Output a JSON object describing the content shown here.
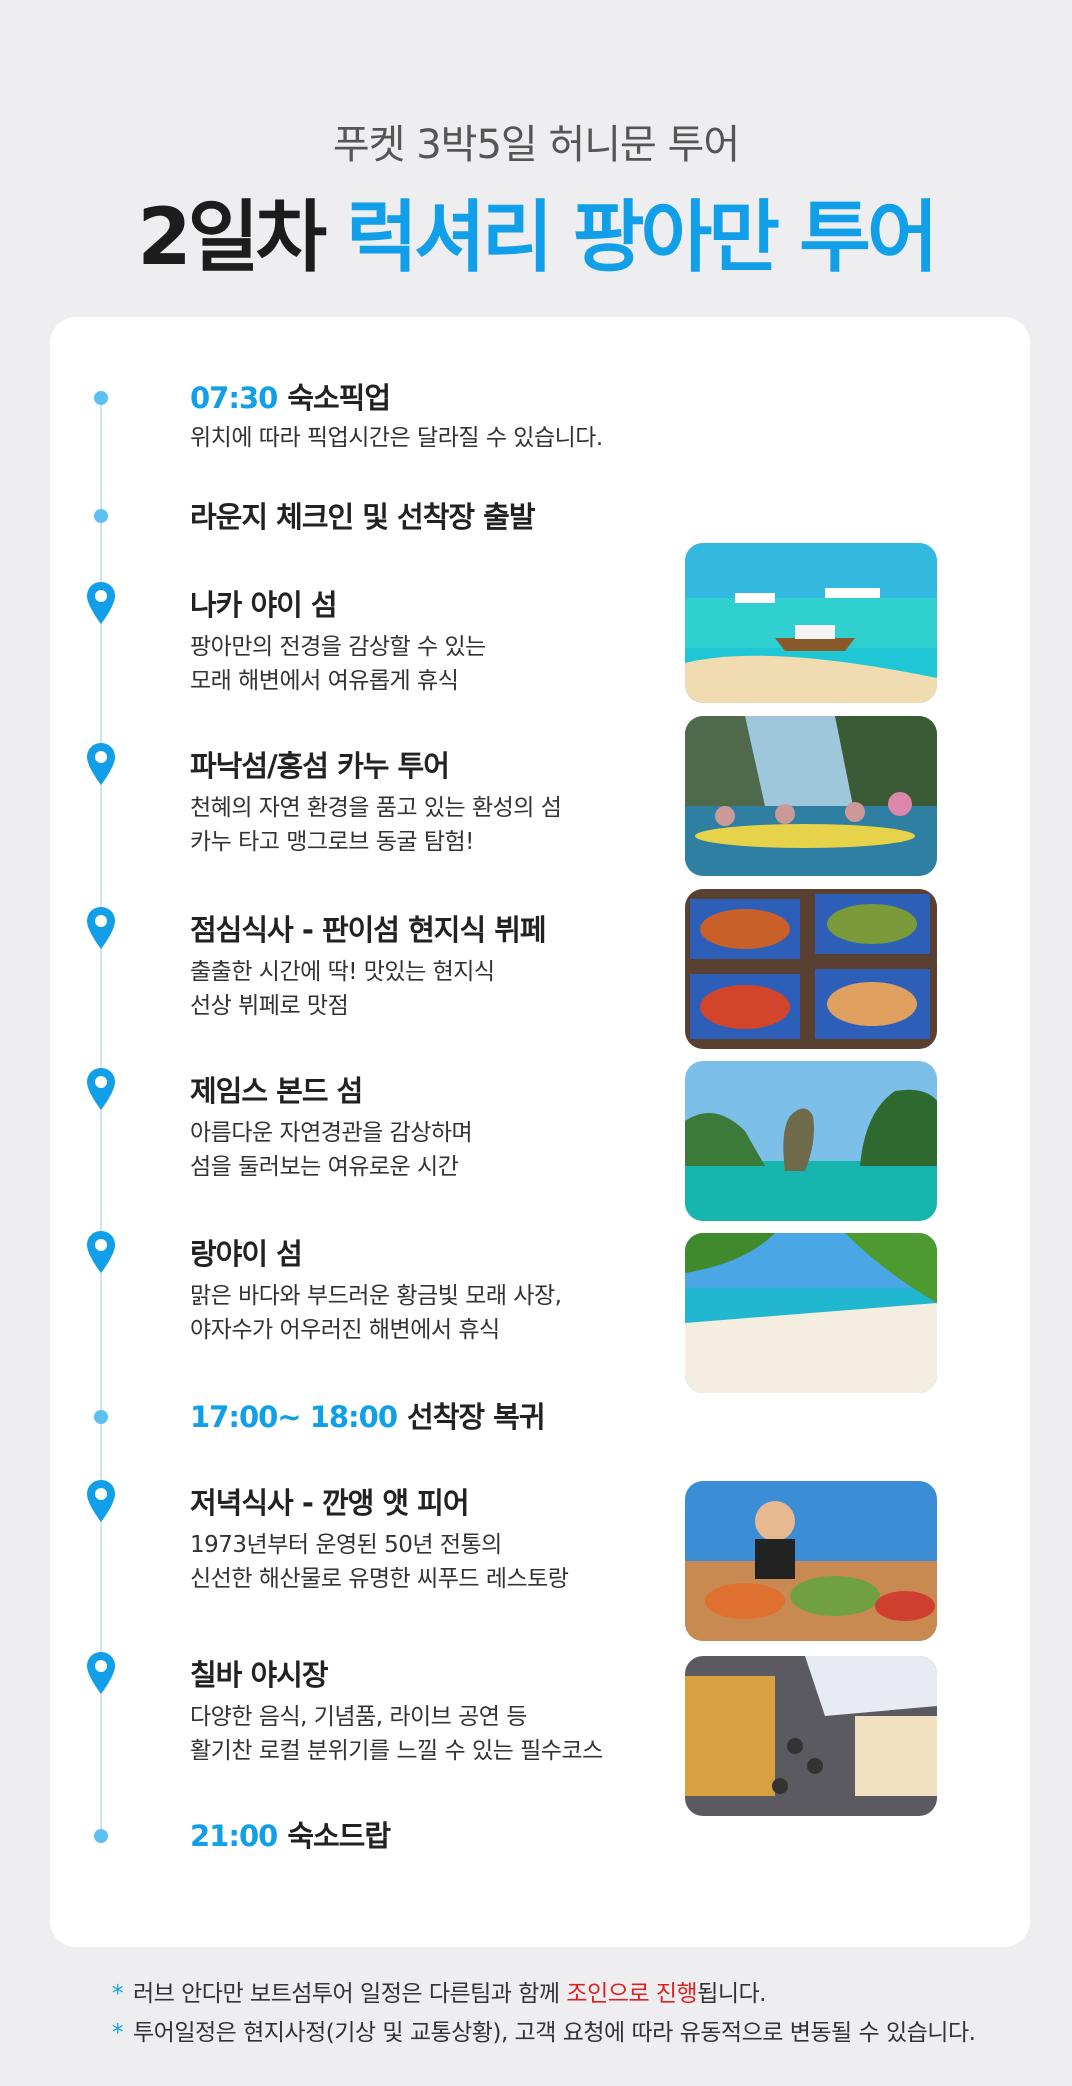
{
  "header": {
    "subtitle": "푸켓 3박5일 허니문 투어",
    "title_day": "2일차",
    "title_main": "럭셔리 팡아만 투어"
  },
  "schedule": [
    {
      "time": "07:30",
      "title": "숙소픽업",
      "desc": [
        "위치에 따라 픽업시간은 달라질 수 있습니다."
      ],
      "marker": "dot"
    },
    {
      "time": "",
      "title": "라운지 체크인 및 선착장 출발",
      "desc": [],
      "marker": "dot"
    },
    {
      "time": "",
      "title": "나카 야이 섬",
      "desc": [
        "팡아만의 전경을 감상할 수 있는",
        "모래 해변에서 여유롭게 휴식"
      ],
      "marker": "location-pin-icon",
      "photo": "beach-boats-photo"
    },
    {
      "time": "",
      "title": "파낙섬/홍섬 카누 투어",
      "desc": [
        "천혜의 자연 환경을 품고 있는 환성의 섬",
        "카누 타고 맹그로브 동굴 탐험!"
      ],
      "marker": "location-pin-icon",
      "photo": "canoe-photo"
    },
    {
      "time": "",
      "title": "점심식사 - 판이섬 현지식 뷔페",
      "desc": [
        "출출한 시간에 딱! 맛있는 현지식",
        "선상 뷔페로 맛점"
      ],
      "marker": "location-pin-icon",
      "photo": "buffet-photo"
    },
    {
      "time": "",
      "title": "제임스 본드 섬",
      "desc": [
        "아름다운 자연경관을 감상하며",
        "섬을 둘러보는 여유로운 시간"
      ],
      "marker": "location-pin-icon",
      "photo": "james-bond-island-photo"
    },
    {
      "time": "",
      "title": "랑야이 섬",
      "desc": [
        "맑은 바다와 부드러운 황금빛 모래 사장,",
        "야자수가 어우러진 해변에서 휴식"
      ],
      "marker": "location-pin-icon",
      "photo": "tropical-beach-photo"
    },
    {
      "time": "17:00~ 18:00",
      "title": "선착장 복귀",
      "desc": [],
      "marker": "dot"
    },
    {
      "time": "",
      "title": "저녁식사 - 깐앵 앳 피어",
      "desc": [
        "1973년부터 운영된 50년 전통의",
        "신선한 해산물로 유명한 씨푸드 레스토랑"
      ],
      "marker": "location-pin-icon",
      "photo": "seafood-dinner-photo"
    },
    {
      "time": "",
      "title": "칠바 야시장",
      "desc": [
        "다양한 음식, 기념품, 라이브 공연 등",
        "활기찬 로컬 분위기를 느낄 수 있는 필수코스"
      ],
      "marker": "location-pin-icon",
      "photo": "night-market-photo"
    },
    {
      "time": "21:00",
      "title": "숙소드랍",
      "desc": [],
      "marker": "dot"
    }
  ],
  "notes": {
    "star": "*",
    "note1_before": "러브 안다만 보트섬투어 일정은 다른팀과 함께 ",
    "note1_highlight": "조인으로 진행",
    "note1_after": "됩니다.",
    "note2": "투어일정은 현지사정(기상 및 교통상황), 고객 요청에 따라 유동적으로 변동될 수 있습니다."
  },
  "colors": {
    "accent": "#109fe8",
    "highlight": "#e02020",
    "background": "#eeeef0"
  }
}
